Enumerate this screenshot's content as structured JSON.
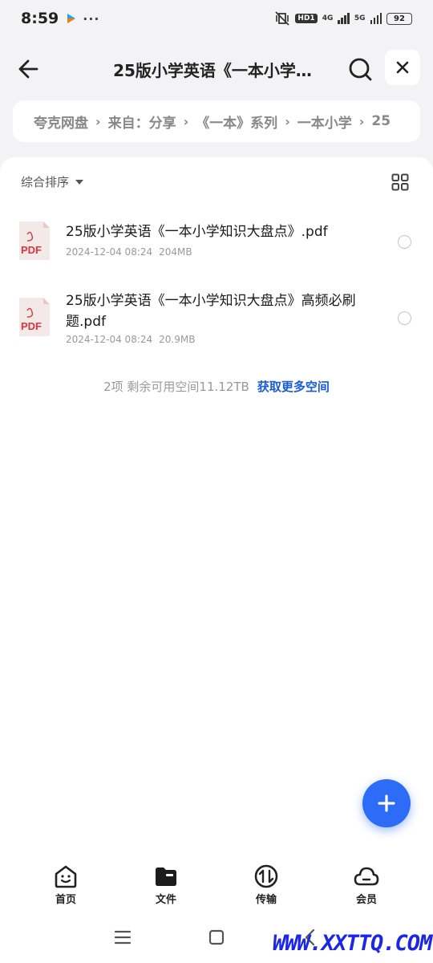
{
  "status_bar": {
    "time": "8:59",
    "dots": "···",
    "hd_label": "HD1",
    "net1": "4G",
    "net2": "5G",
    "battery": "92"
  },
  "header": {
    "title": "25版小学英语《一本小学…"
  },
  "breadcrumb": {
    "items": [
      "夸克网盘",
      "来自：分享",
      "《一本》系列",
      "一本小学",
      "25"
    ]
  },
  "toolbar": {
    "sort_label": "综合排序"
  },
  "files": [
    {
      "name": "25版小学英语《一本小学知识大盘点》.pdf",
      "date": "2024-12-04 08:24",
      "size": "204MB",
      "icon_label": "PDF"
    },
    {
      "name": "25版小学英语《一本小学知识大盘点》高频必刷题.pdf",
      "date": "2024-12-04 08:24",
      "size": "20.9MB",
      "icon_label": "PDF"
    }
  ],
  "storage": {
    "summary": "2项 剩余可用空间11.12TB",
    "link": "获取更多空间"
  },
  "tabs": [
    {
      "label": "首页",
      "icon": "home-icon"
    },
    {
      "label": "文件",
      "icon": "folder-icon"
    },
    {
      "label": "传输",
      "icon": "transfer-icon"
    },
    {
      "label": "会员",
      "icon": "cloud-icon"
    }
  ],
  "watermark": "WWW.XXTTQ.COM",
  "colors": {
    "accent": "#2c6cf6",
    "link": "#1a5bdc",
    "pdf_red": "#d9363e"
  }
}
